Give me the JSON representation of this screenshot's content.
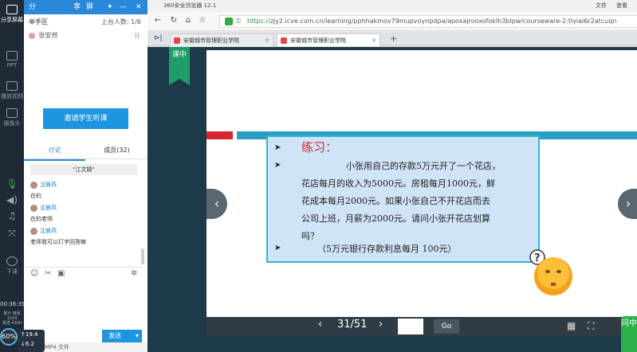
{
  "left_toolbar": {
    "share_screen": "分享屏幕",
    "ppt": "PPT",
    "play_video": "播放视频",
    "camera": "摄像头",
    "end_class": "下课",
    "elapsed_time": "00:36:39",
    "stats_line1": "累计 接收",
    "stats_line2": "1024",
    "stats_line3": "发送 4300",
    "network_quality": "60%",
    "upload_speed": "↑19.4",
    "download_speed": "↓6.2"
  },
  "panel": {
    "header_tabs": [
      "分",
      "享",
      "屏"
    ],
    "hand_raise_label": "举手区",
    "online_count_label": "上台人数: 1/6",
    "member_name": "张安然",
    "invite_button": "邀请学生听课",
    "tab_discussion": "讨论",
    "tab_members": "成员(32)",
    "system_message": "\"江文婧\"",
    "messages": [
      {
        "name": "沈晨燕",
        "text": "在的"
      },
      {
        "name": "沈晨燕",
        "text": "在的老师"
      },
      {
        "name": "沈晨燕",
        "text": "老师我可以打字回答嘛"
      }
    ],
    "send_button": "发送",
    "bottom_text": "MP4 文件"
  },
  "browser": {
    "app_title": "360安全浏览器 12.1",
    "menu_file": "文件",
    "menu_view": "查看",
    "url_scheme": "https://",
    "url_rest": "zjy2.icve.com.cn/learning/pphhakmov79mupvoynpdpa/apoxajrooxofoklh3blpw/courseware-2:tlyiai6r2atcuqn",
    "tabs": [
      "安徽城市管理职业学院",
      "安徽城市管理职业学院"
    ]
  },
  "slide": {
    "bookmark_label": "课中",
    "title": "练习：",
    "lines": [
      "小张用自己的存款5万元开了一个花店，",
      "花店每月的收入为5000元。房租每月1000元，鲜",
      "花成本每月2000元。如果小张自己不开花店而去",
      "公司上班，月薪为2000元。请问小张开花店划算",
      "吗？"
    ],
    "note": "（5万元银行存款利息每月 100元）",
    "bullet": "➤",
    "page_indicator": "31/51",
    "go_button": "Go",
    "corner_button": "问中"
  },
  "colors": {
    "accent_blue": "#2b87d8",
    "slide_red": "#d7262e",
    "slide_teal": "#2b9dc4",
    "bookmark_green": "#1e9d6b"
  }
}
